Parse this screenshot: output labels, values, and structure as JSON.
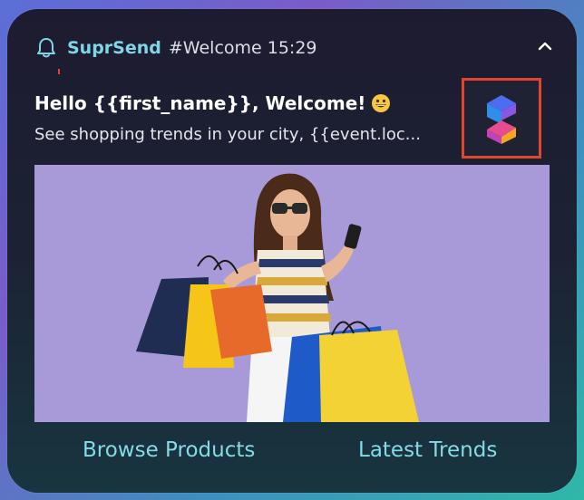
{
  "header": {
    "app_name": "SuprSend",
    "meta": "#Welcome 15:29"
  },
  "notification": {
    "title": "Hello {{first_name}}, Welcome!",
    "subtitle": "See shopping trends in your city, {{event.loc..."
  },
  "icons": {
    "bell": "bell-icon",
    "collapse": "chevron-up-icon",
    "emoji": "grinning-face-emoji",
    "logo": "suprsend-logo"
  },
  "actions": [
    {
      "label": "Browse Products"
    },
    {
      "label": "Latest Trends"
    }
  ],
  "colors": {
    "accent": "#7fd6e6",
    "highlight_border": "#e2442e",
    "image_background": "#a89ad8"
  }
}
